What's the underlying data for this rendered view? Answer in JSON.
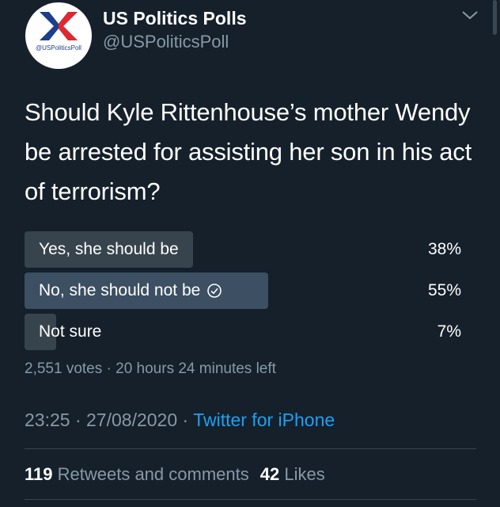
{
  "header": {
    "display_name": "US Politics Polls",
    "handle": "@USPoliticsPoll",
    "avatar_text": "@USPoliticsPoll",
    "more_icon": "chevron-down-icon"
  },
  "tweet": {
    "text": "Should Kyle Rittenhouse’s mother Wendy be arrested for assisting her son in his act of terrorism?"
  },
  "poll": {
    "options": [
      {
        "label": "Yes, she should be",
        "percent": "38%",
        "fill_fraction": 0.38,
        "winner": false
      },
      {
        "label": "No, she should not be",
        "percent": "55%",
        "fill_fraction": 0.55,
        "winner": true
      },
      {
        "label": "Not sure",
        "percent": "7%",
        "fill_fraction": 0.07,
        "winner": false
      }
    ],
    "votes": "2,551 votes",
    "separator": "·",
    "time_left": "20 hours 24 minutes left"
  },
  "meta": {
    "time": "23:25",
    "date": "27/08/2020",
    "separator": "·",
    "source": "Twitter for iPhone"
  },
  "stats": {
    "retweets_count": "119",
    "retweets_label": "Retweets and comments",
    "likes_count": "42",
    "likes_label": "Likes"
  },
  "colors": {
    "background": "#15202b",
    "bar": "#38444d",
    "bar_winner": "#3c4f63",
    "link": "#1da1f2",
    "muted": "#8899a6",
    "logo_blue": "#1b3f8a",
    "logo_red": "#e0282e"
  }
}
